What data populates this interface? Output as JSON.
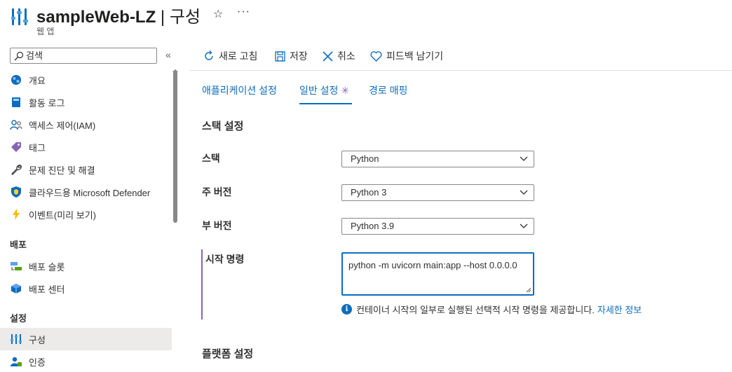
{
  "header": {
    "title_main": "sampleWeb-LZ",
    "title_sep": " | ",
    "title_page": "구성",
    "subtitle": "웹 앱",
    "star_glyph": "☆",
    "more_glyph": "···"
  },
  "sidebar": {
    "search_placeholder": "검색",
    "collapse_glyph": "«",
    "items": [
      {
        "label": "개요",
        "icon": "globe-icon"
      },
      {
        "label": "활동 로그",
        "icon": "log-icon"
      },
      {
        "label": "액세스 제어(IAM)",
        "icon": "people-icon"
      },
      {
        "label": "태그",
        "icon": "tag-icon"
      },
      {
        "label": "문제 진단 및 해결",
        "icon": "wrench-icon"
      },
      {
        "label": "클라우드용 Microsoft Defender",
        "icon": "shield-icon"
      },
      {
        "label": "이벤트(미리 보기)",
        "icon": "lightning-icon"
      }
    ],
    "section_deploy": "배포",
    "deploy_items": [
      {
        "label": "배포 슬롯",
        "icon": "slots-icon"
      },
      {
        "label": "배포 센터",
        "icon": "cube-icon"
      }
    ],
    "section_settings": "설정",
    "settings_items": [
      {
        "label": "구성",
        "icon": "config-icon",
        "active": true
      },
      {
        "label": "인증",
        "icon": "auth-icon"
      }
    ]
  },
  "toolbar": {
    "refresh": "새로 고침",
    "save": "저장",
    "discard": "취소",
    "feedback": "피드백 남기기"
  },
  "tabs": {
    "app_settings": "애플리케이션 설정",
    "general": "일반 설정",
    "general_dirty": "✳",
    "path_mappings": "경로 매핑"
  },
  "form": {
    "stack_section": "스택 설정",
    "stack_label": "스택",
    "stack_value": "Python",
    "major_label": "주 버전",
    "major_value": "Python 3",
    "minor_label": "부 버전",
    "minor_value": "Python 3.9",
    "startup_label": "시작 명령",
    "startup_value": "python -m uvicorn main:app --host 0.0.0.0",
    "help_text": "컨테이너 시작의 일부로 실행된 선택적 시작 명령을 제공합니다.",
    "help_link": "자세한 정보",
    "platform_section": "플랫폼 설정"
  },
  "colors": {
    "accent": "#0f6cbd",
    "modified": "#8764b8",
    "active_nav_bg": "#edebe9"
  }
}
